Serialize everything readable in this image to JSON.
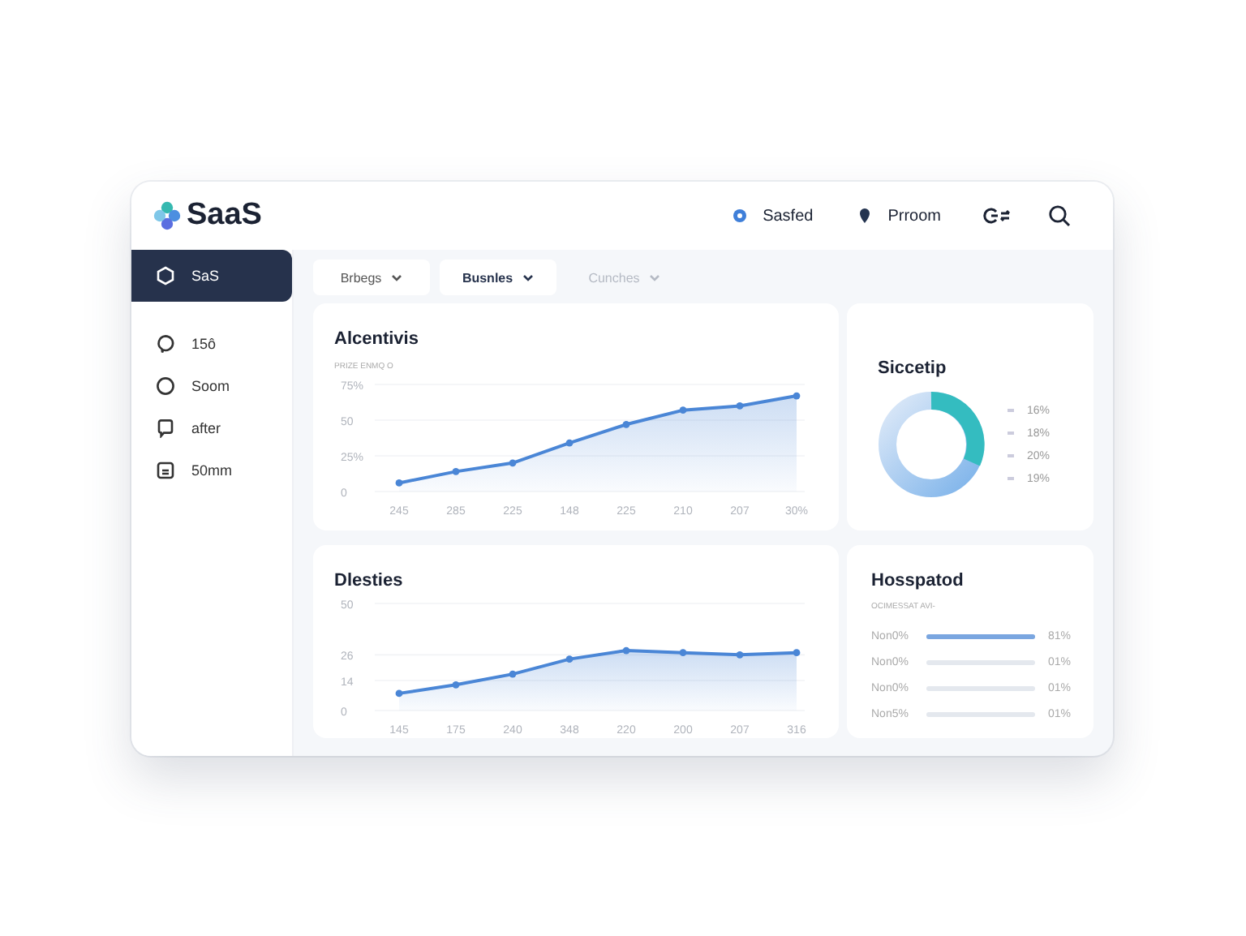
{
  "header": {
    "brand": "SaaS",
    "links": [
      {
        "label": "Sasfed",
        "kind": "dot"
      },
      {
        "label": "Prroom",
        "kind": "pin"
      }
    ]
  },
  "sidebar": {
    "items": [
      {
        "label": "SaS",
        "selected": true,
        "kind": "hex"
      },
      {
        "label": "15ô",
        "selected": false,
        "kind": "bubble"
      },
      {
        "label": "Soom",
        "selected": false,
        "kind": "circle"
      },
      {
        "label": "after",
        "selected": false,
        "kind": "chat"
      },
      {
        "label": "50mm",
        "selected": false,
        "kind": "doc"
      }
    ]
  },
  "filters": [
    {
      "label": "Brbegs",
      "selected": false,
      "disabled": false
    },
    {
      "label": "Busnles",
      "selected": true,
      "disabled": false
    },
    {
      "label": "Cunches",
      "selected": false,
      "disabled": true
    }
  ],
  "charts": [
    {
      "title": "Alcentivis",
      "subtitle": "PRIZE ENMQ O",
      "chart_data": {
        "type": "area",
        "categories": [
          "245",
          "285",
          "225",
          "148",
          "225",
          "210",
          "207",
          "30%"
        ],
        "series": [
          {
            "color": "#4a86d6",
            "values": [
              6,
              14,
              20,
              34,
              47,
              57,
              60,
              67
            ]
          }
        ],
        "ylim": [
          0,
          75
        ],
        "yticks": [
          0,
          {
            "value": 25,
            "label": "25%"
          },
          50,
          {
            "value": 75,
            "label": "75%"
          }
        ]
      }
    },
    {
      "title": "Dlesties",
      "chart_data": {
        "type": "area",
        "categories": [
          "145",
          "175",
          "240",
          "348",
          "220",
          "200",
          "207",
          "316"
        ],
        "series": [
          {
            "color": "#4a86d6",
            "values": [
              8,
              12,
              17,
              24,
              28,
              27,
              26,
              27
            ]
          }
        ],
        "ylim": [
          0,
          50
        ],
        "yticks": [
          0,
          14,
          26,
          50
        ]
      }
    }
  ],
  "donut": {
    "title": "Siccetip",
    "legend": [
      "16%",
      "18%",
      "20%",
      "19%"
    ]
  },
  "bars": {
    "title": "Hosspatod",
    "subtitle": "OCIMESSAT AVI-",
    "rows": [
      {
        "label": "Non0%",
        "level": 1,
        "value": "81%"
      },
      {
        "label": "Non0%",
        "level": 0,
        "value": "01%"
      },
      {
        "label": "Non0%",
        "level": 0,
        "value": "01%"
      },
      {
        "label": "Non5%",
        "level": 0,
        "value": "01%"
      }
    ]
  }
}
